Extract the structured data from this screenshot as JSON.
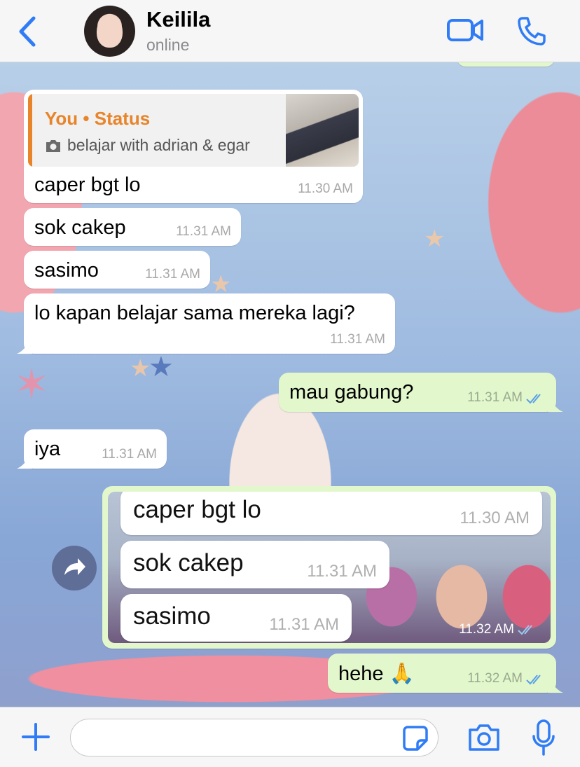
{
  "header": {
    "contact_name": "Keilila",
    "contact_status": "online"
  },
  "messages": [
    {
      "id": "m1",
      "direction": "incoming",
      "reply": {
        "title": "You • Status",
        "text": "belajar with adrian & egar",
        "icon": "camera-icon"
      },
      "text": "caper bgt lo",
      "time": "11.30 AM"
    },
    {
      "id": "m2",
      "direction": "incoming",
      "text": "sok cakep",
      "time": "11.31 AM"
    },
    {
      "id": "m3",
      "direction": "incoming",
      "text": "sasimo",
      "time": "11.31 AM"
    },
    {
      "id": "m4",
      "direction": "incoming",
      "text": "lo kapan belajar sama mereka lagi?",
      "time": "11.31 AM"
    },
    {
      "id": "m5",
      "direction": "outgoing",
      "text": "mau gabung?",
      "time": "11.31 AM",
      "read": true
    },
    {
      "id": "m6",
      "direction": "incoming",
      "text": "iya",
      "time": "11.31 AM"
    },
    {
      "id": "m7",
      "direction": "outgoing",
      "type": "image",
      "time": "11.32 AM",
      "read": true,
      "image_bubbles": [
        {
          "text": "caper bgt lo",
          "time": "11.30 AM"
        },
        {
          "text": "sok cakep",
          "time": "11.31 AM"
        },
        {
          "text": "sasimo",
          "time": "11.31 AM"
        }
      ]
    },
    {
      "id": "m8",
      "direction": "outgoing",
      "text": "hehe 🙏",
      "time": "11.32 AM",
      "read": true
    }
  ],
  "input": {
    "placeholder": ""
  },
  "colors": {
    "accent": "#2f7cf6",
    "outgoing_bubble": "#e2f7cb",
    "incoming_bubble": "#ffffff",
    "reply_title": "#e8842a",
    "read_ticks": "#5aa0e8"
  }
}
